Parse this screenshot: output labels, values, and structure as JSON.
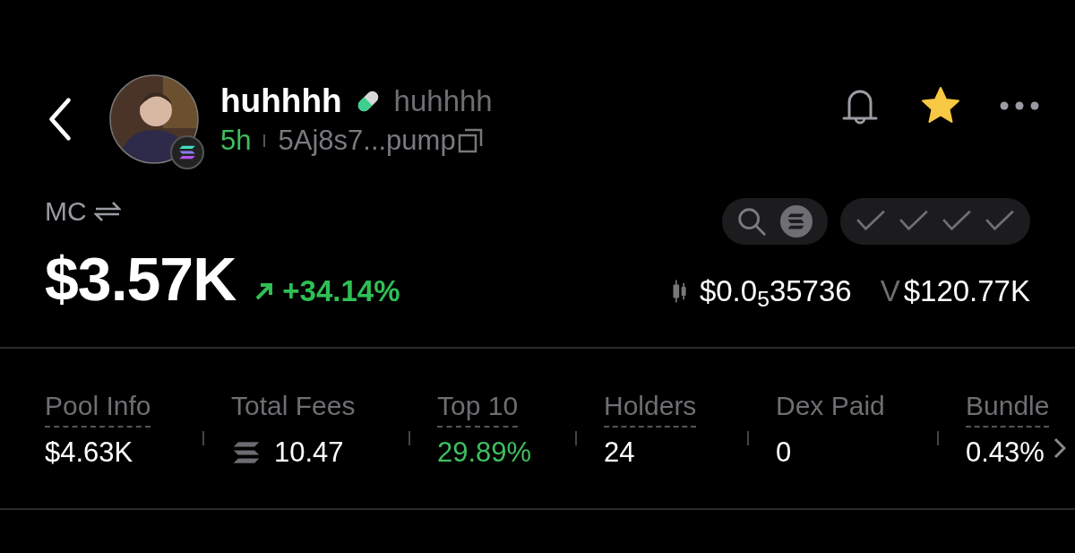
{
  "header": {
    "name": "huhhhh",
    "symbol": "huhhhh",
    "age": "5h",
    "address": "5Aj8s7...pump",
    "favorite": true
  },
  "market": {
    "label": "MC",
    "value": "$3.57K",
    "change": "+34.14%",
    "price": "$0.0$_{5}$35736",
    "volume_label": "V",
    "volume": "$120.77K"
  },
  "checks": [
    {
      "checked": true
    },
    {
      "checked": true
    },
    {
      "checked": true
    },
    {
      "checked": true
    }
  ],
  "stats": [
    {
      "label": "Pool Info",
      "value": "$4.63K",
      "dashed": true,
      "positive": false,
      "kind": "plain"
    },
    {
      "label": "Total Fees",
      "value": "10.47",
      "dashed": false,
      "positive": false,
      "kind": "sol"
    },
    {
      "label": "Top 10",
      "value": "29.89%",
      "dashed": true,
      "positive": true,
      "kind": "plain"
    },
    {
      "label": "Holders",
      "value": "24",
      "dashed": true,
      "positive": false,
      "kind": "plain"
    },
    {
      "label": "Dex Paid",
      "value": "0",
      "dashed": false,
      "positive": false,
      "kind": "plain"
    },
    {
      "label": "Bundle",
      "value": "0.43%",
      "dashed": true,
      "positive": false,
      "kind": "plain"
    }
  ]
}
